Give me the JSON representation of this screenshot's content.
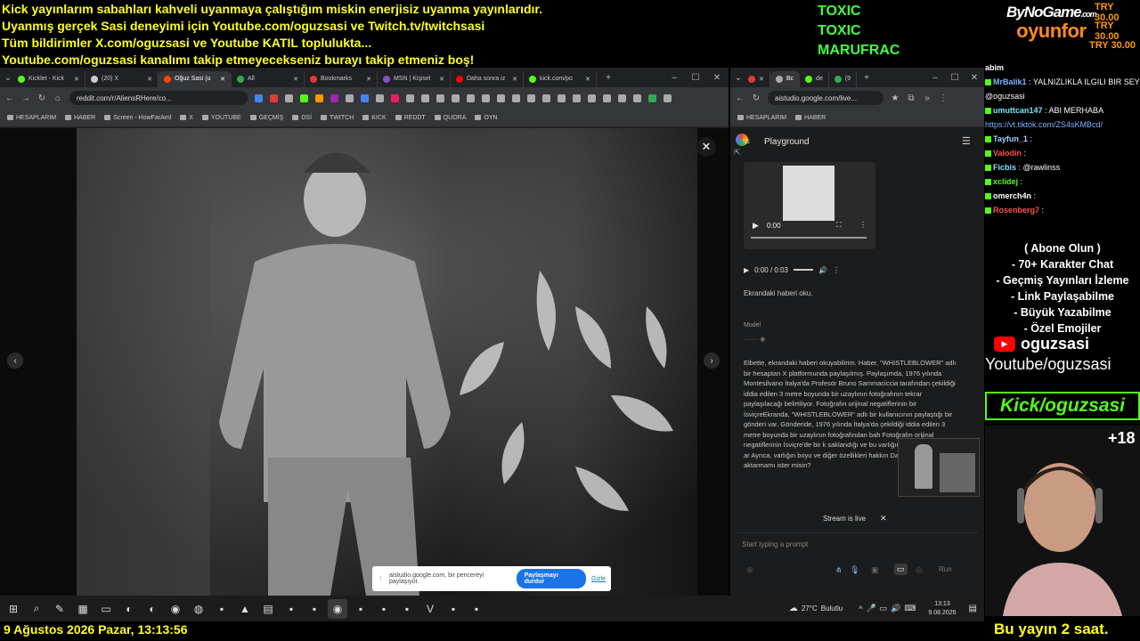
{
  "banner": {
    "lines": [
      "Kick yayınlarım sabahları kahveli uyanmaya çalıştığım miskin enerjisiz uyanma yayınlarıdır.",
      "Uyanmış gerçek Sasi deneyimi için Youtube.com/oguzsasi ve Twitch.tv/twitchsasi",
      "Tüm bildirimler X.com/oguzsasi ve Youtube KATIL toplulukta...",
      "Youtube.com/oguzsasi kanalımı takip etmeyecekseniz burayı takip etmeniz boş!"
    ],
    "toxic": [
      "TOXIC",
      "TOXIC",
      "MARUFRAC"
    ],
    "brand_top": "ByNoGame",
    "brand_com": ".com",
    "brand_bottom": "oyunfor",
    "try": [
      "TRY 30.00",
      "TRY 30.00",
      "TRY 30.00"
    ]
  },
  "browser1": {
    "tabs": [
      {
        "label": "Kicklet - Kick",
        "color": "#53fc18"
      },
      {
        "label": "(20) X",
        "color": "#cccccc"
      },
      {
        "label": "Oğuz Sasi (u",
        "color": "#ff4500"
      },
      {
        "label": "All",
        "color": "#34a853"
      },
      {
        "label": "Bookmarks",
        "color": "#e53935"
      },
      {
        "label": "MSN | Kişisel",
        "color": "#7e57c2"
      },
      {
        "label": "Daha sonra iz",
        "color": "#ff0000"
      },
      {
        "label": "kick.com/po",
        "color": "#53fc18"
      }
    ],
    "url": "reddit.com/r/AliensRHere/co...",
    "bookmarks": [
      "HESAPLARIM",
      "HABER",
      "Screen - HowFarAml",
      "X",
      "YOUTUBE",
      "GEÇMİŞ",
      "DSİ",
      "TWITCH",
      "KICK",
      "REDDT",
      "QUORA",
      "OYN"
    ],
    "share": {
      "text": "aistudio.google.com, bir pencereyi paylaşıyor.",
      "stop": "Paylaşmayı durdur",
      "hide": "Gizle"
    }
  },
  "browser2": {
    "url": "aistudio.google.com/live...",
    "bookmarks": [
      "HESAPLARIM",
      "HABER"
    ],
    "title": "Playground",
    "video_time": "0:00",
    "audio_time": "0:00 / 0:03",
    "user_msg": "Ekrandaki haberi oku.",
    "model_label": "Model",
    "model_text": "Elbette, ekrandaki haberi okuyabilirim. Haber, \"WHISTLEBLOWER\" adlı bir hesaptan X platformunda paylaşılmış. Paylaşımda, 1976 yılında Montesilvano İtalya'da Profesör Bruno Sammaciccia tarafından çekildiği iddia edilen 3 metre boyunda bir uzaylının fotoğrafının tekrar paylaşılacağı belirtiliyor. Fotoğrafın orijinal negatiflerinin bir İsviçreEkranda, \"WHISTLEBLOWER\" adlı bir kullanıcının paylaştığı bir gönderi var. Gönderide, 1976 yılında İtalya'da çekildiği iddia edilen 3 metre boyunda bir uzaylının fotoğrafından bah Fotoğrafın orijinal negatiflerinin İsviçre'de bir k saklandığı ve bu varlığın \"Dimpietro\" adıyla ar Ayrıca, varlığın boyu ve diğer özellikleri hakkın Daha detaylı bilgi aktarmamı ister misin?",
    "stream_live": "Stream is live",
    "prompt_placeholder": "Start typing a prompt",
    "run": "Run"
  },
  "chat": {
    "messages": [
      {
        "user": "abim",
        "text": "",
        "color": "#ffffff"
      },
      {
        "user": "MrBalik1",
        "text": ": YALNIZLIKLA ILGILI BIR SEY ANLATACAKTIN ACIL ANLAT",
        "color": "#7fb3ff"
      },
      {
        "user": "",
        "text": "@oguzsasi",
        "color": "#ffffff"
      },
      {
        "user": "umuttcan147",
        "text": ": ABI MERHABA",
        "color": "#7fe3ff"
      },
      {
        "user": "",
        "text": "https://vt.tiktok.com/ZS4sKMBcd/",
        "color": "#7fb3ff"
      },
      {
        "user": "Tayfun_1",
        "text": ":",
        "color": "#a0d0ff"
      },
      {
        "user": "Valodin",
        "text": ":",
        "color": "#ff5050"
      },
      {
        "user": "Ficbis",
        "text": ": @rawlinss",
        "color": "#7fe3ff"
      },
      {
        "user": "xclidej",
        "text": ":",
        "color": "#53fc18"
      },
      {
        "user": "omerch4n",
        "text": ":",
        "color": "#ffffff"
      },
      {
        "user": "Rosenberg7",
        "text": ":",
        "color": "#ff5050"
      }
    ]
  },
  "promo": [
    "( Abone Olun )",
    "- 70+ Karakter Chat",
    "- Geçmiş Yayınları İzleme",
    "- Link Paylaşabilme",
    "- Büyük Yazabilme",
    "- Özel Emojiler"
  ],
  "youtube": {
    "handle": "oguzsasi",
    "link": "Youtube/oguzsasi"
  },
  "kick_label": "Kick/oguzsasi",
  "plus18": "+18",
  "taskbar": {
    "weather": "27°C",
    "weather_desc": "Bulutlu",
    "time": "13:13",
    "date": "9.08.2026",
    "apps": [
      "start-icon",
      "search-icon",
      "pen-icon",
      "folder-icon",
      "monitor-icon",
      "edge-icon",
      "edge-icon",
      "camera-icon",
      "chrome-alt-icon",
      "app-icon",
      "triangle-icon",
      "note-icon",
      "app-icon",
      "app-icon",
      "chrome-icon",
      "app-icon",
      "app-icon",
      "app-icon",
      "vivaldi-icon",
      "app-icon",
      "app-icon"
    ]
  },
  "bottom": {
    "datetime": "9 Ağustos 2026 Pazar, 13:13:56",
    "message": "Bu yayın 2 saat."
  }
}
